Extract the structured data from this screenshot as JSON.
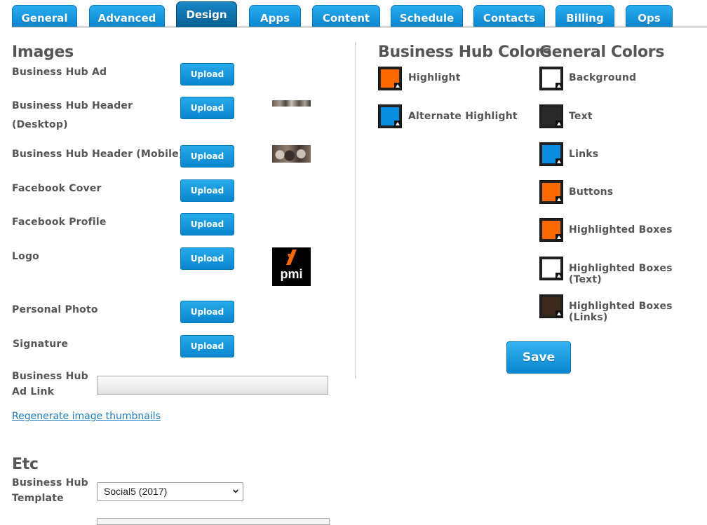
{
  "tabs": [
    "General",
    "Advanced",
    "Design",
    "Apps",
    "Content",
    "Schedule",
    "Contacts",
    "Billing",
    "Ops"
  ],
  "active_tab": "Design",
  "images": {
    "heading": "Images",
    "upload_label": "Upload",
    "rows": [
      {
        "label": "Business Hub Ad"
      },
      {
        "label_line1": "Business Hub Header",
        "label_line2": "(Desktop)"
      },
      {
        "label": "Business Hub Header (Mobile)"
      },
      {
        "label": "Facebook Cover"
      },
      {
        "label": "Facebook Profile"
      },
      {
        "label": "Logo"
      },
      {
        "label": "Personal Photo"
      },
      {
        "label": "Signature"
      }
    ],
    "logo_text": "pmi",
    "ad_link_label_line1": "Business Hub",
    "ad_link_label_line2": "Ad Link",
    "ad_link_value": "",
    "regenerate_link": "Regenerate image thumbnails"
  },
  "etc": {
    "heading": "Etc",
    "template_label_line1": "Business Hub",
    "template_label_line2": "Template",
    "template_selected": "Social5 (2017)"
  },
  "hub_colors": {
    "heading": "Business Hub Colors",
    "items": [
      {
        "label": "Highlight",
        "color": "#ff6a00"
      },
      {
        "label": "Alternate Highlight",
        "color": "#0a8fe0"
      }
    ]
  },
  "general_colors": {
    "heading": "General Colors",
    "items": [
      {
        "label": "Background",
        "color": "#ffffff"
      },
      {
        "label": "Text",
        "color": "#2a2a2a"
      },
      {
        "label": "Links",
        "color": "#0a8fe0"
      },
      {
        "label": "Buttons",
        "color": "#ff6a00"
      },
      {
        "label": "Highlighted Boxes",
        "color": "#ff6a00"
      },
      {
        "label": "Highlighted Boxes (Text)",
        "color": "#ffffff"
      },
      {
        "label": "Highlighted Boxes (Links)",
        "color": "#3b2a1a"
      }
    ]
  },
  "save_label": "Save"
}
